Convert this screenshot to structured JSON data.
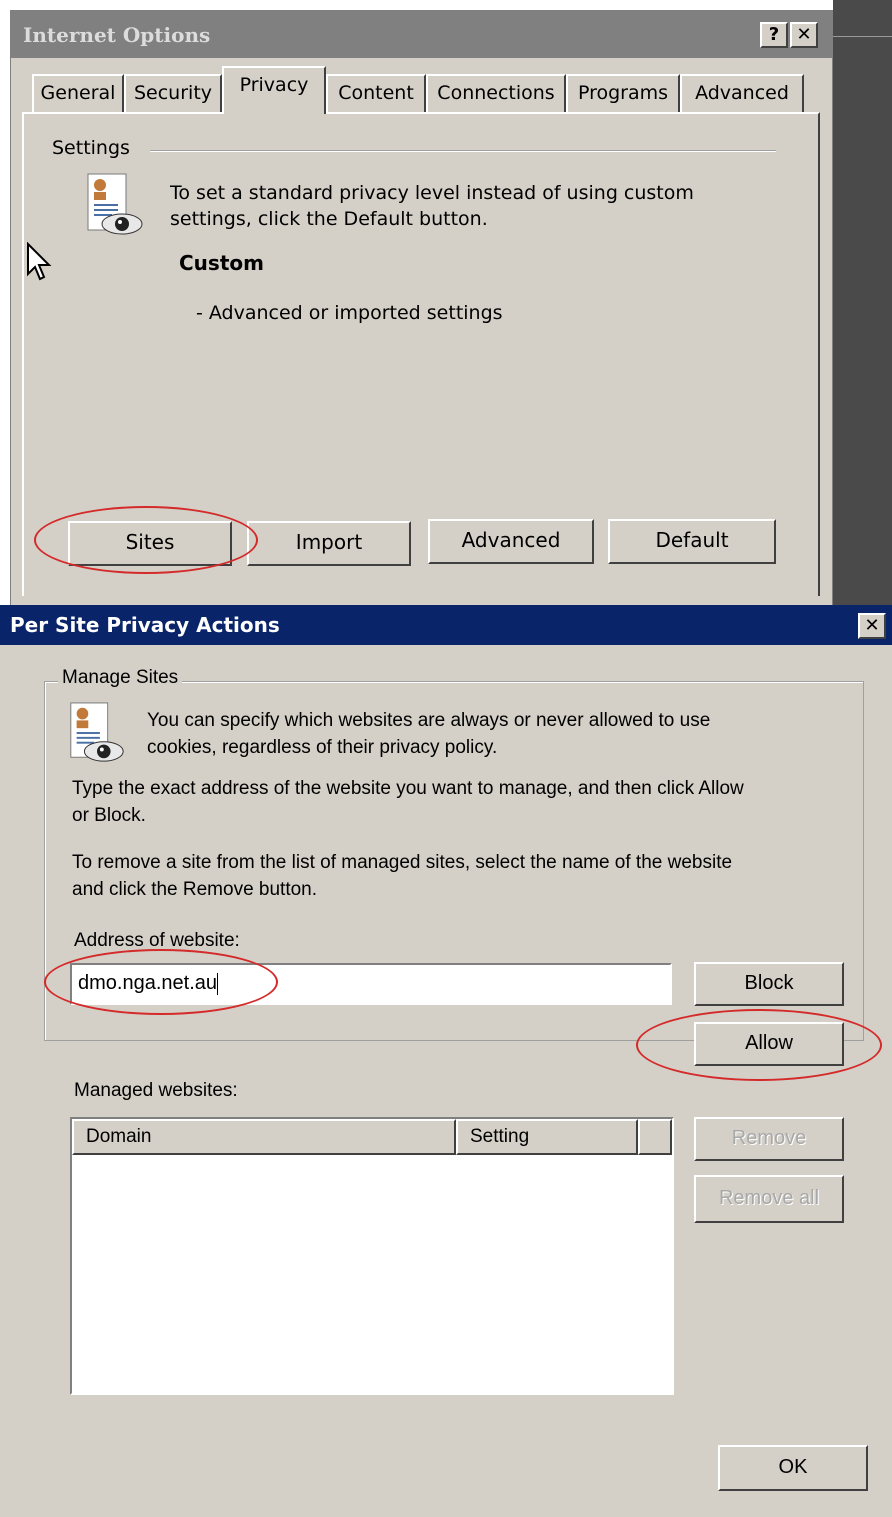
{
  "internet_options": {
    "title": "Internet Options",
    "help_button": "?",
    "close_button": "✕",
    "tabs": [
      {
        "label": "General",
        "active": false
      },
      {
        "label": "Security",
        "active": false
      },
      {
        "label": "Privacy",
        "active": true
      },
      {
        "label": "Content",
        "active": false
      },
      {
        "label": "Connections",
        "active": false
      },
      {
        "label": "Programs",
        "active": false
      },
      {
        "label": "Advanced",
        "active": false
      }
    ],
    "settings_label": "Settings",
    "description_line1": "To set a standard privacy level instead of using custom",
    "description_line2": "settings, click the Default button.",
    "level_name": "Custom",
    "level_detail": "- Advanced or imported settings",
    "buttons": {
      "sites": "Sites",
      "import": "Import",
      "advanced": "Advanced",
      "default": "Default"
    }
  },
  "per_site": {
    "title": "Per Site Privacy Actions",
    "close_button": "✕",
    "group_label": "Manage Sites",
    "intro_line1": "You can specify which websites are always or never allowed to use",
    "intro_line2": "cookies, regardless of their privacy policy.",
    "instruction1_line1": "Type the exact address of the website you want to manage, and then click Allow",
    "instruction1_line2": "or Block.",
    "instruction2_line1": "To remove a site from the list of managed sites, select the name of the website",
    "instruction2_line2": "and click the Remove button.",
    "address_label": "Address of website:",
    "address_value": "dmo.nga.net.au",
    "managed_label": "Managed websites:",
    "columns": {
      "domain": "Domain",
      "setting": "Setting"
    },
    "buttons": {
      "block": "Block",
      "allow": "Allow",
      "remove": "Remove",
      "remove_all": "Remove all",
      "ok": "OK"
    }
  },
  "colors": {
    "dialog_face": "#d4d0c8",
    "titlebar_active": "#0a246a",
    "titlebar_inactive": "#808080",
    "annotation_red": "#d42a2a"
  }
}
